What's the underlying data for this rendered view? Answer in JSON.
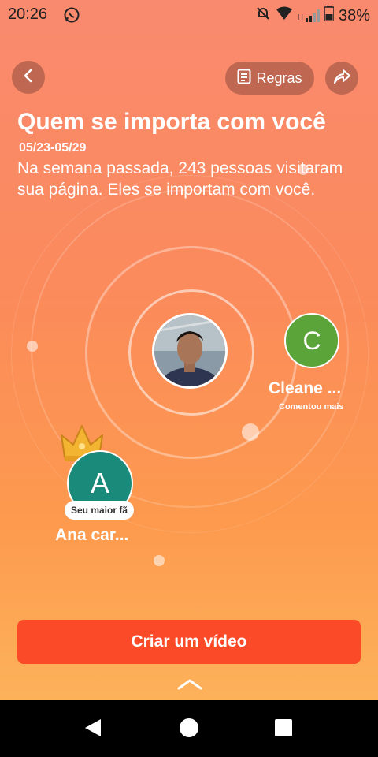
{
  "status_bar": {
    "time": "20:26",
    "network_label": "H",
    "battery": "38%"
  },
  "header": {
    "back_icon": "chevron-left-icon",
    "rules_icon": "document-list-icon",
    "rules_label": "Regras",
    "share_icon": "share-arrow-icon"
  },
  "main": {
    "title": "Quem se importa com você",
    "date_range": "05/23-05/29",
    "description": "Na semana passada, 243 pessoas visitaram sua página. Eles se importam com você."
  },
  "friends": [
    {
      "initial": "C",
      "name": "Cleane ...",
      "tag": "Comentou mais",
      "color": "#5aa43a"
    },
    {
      "initial": "A",
      "name": "Ana car...",
      "tag": "Seu maior fã",
      "color": "#1a8a7a"
    }
  ],
  "cta": {
    "label": "Criar um vídeo"
  },
  "colors": {
    "accent": "#fb4a27",
    "background_top": "#f98a6f",
    "background_bottom": "#fdb25a"
  }
}
